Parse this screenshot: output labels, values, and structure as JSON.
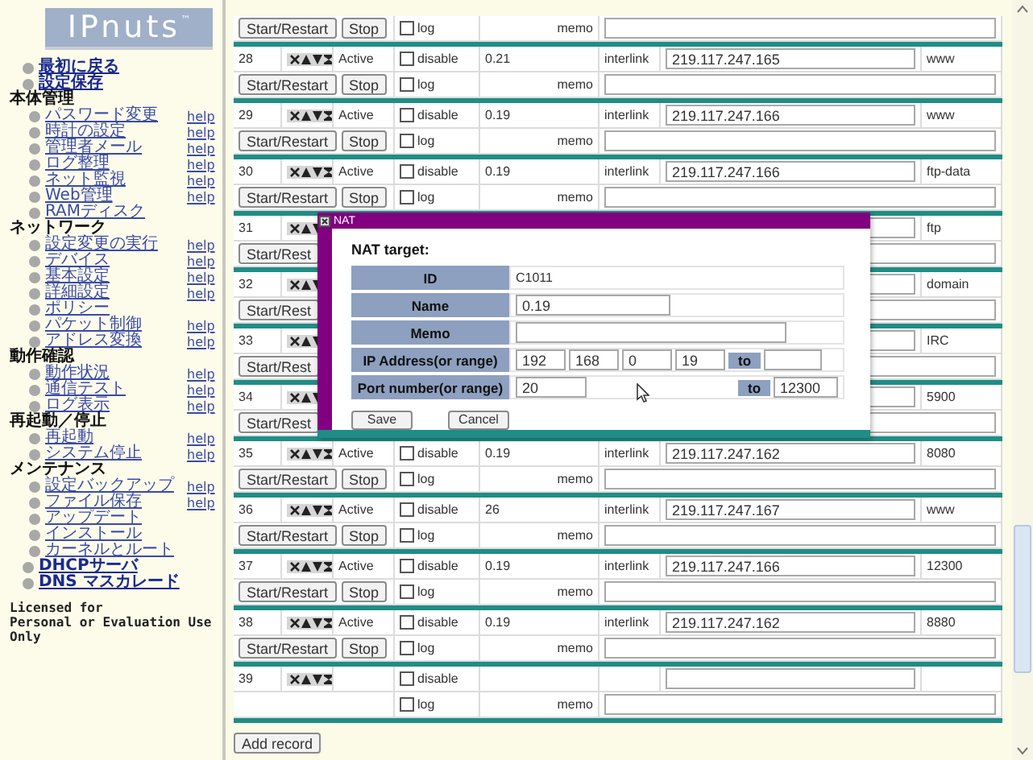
{
  "logo": {
    "text": "IPnuts",
    "mark": "™"
  },
  "menu": [
    {
      "kind": "link",
      "label": "最初に戻る"
    },
    {
      "kind": "link",
      "label": "設定保存"
    },
    {
      "kind": "section",
      "label": "本体管理",
      "children": [
        {
          "label": "パスワード変更",
          "help": "help"
        },
        {
          "label": "時計の設定",
          "help": "help"
        },
        {
          "label": "管理者メール",
          "help": "help"
        },
        {
          "label": "ログ整理",
          "help": "help"
        },
        {
          "label": "ネット監視",
          "help": "help"
        },
        {
          "label": "Web管理",
          "help": "help"
        },
        {
          "label": "RAMディスク"
        }
      ]
    },
    {
      "kind": "section",
      "label": "ネットワーク",
      "children": [
        {
          "label": "設定変更の実行",
          "help": "help"
        },
        {
          "label": "デバイス",
          "help": "help"
        },
        {
          "label": "基本設定",
          "help": "help"
        },
        {
          "label": "詳細設定",
          "help": "help"
        },
        {
          "label": "ポリシー"
        },
        {
          "label": "パケット制御",
          "help": "help"
        },
        {
          "label": "アドレス変換",
          "help": "help"
        }
      ]
    },
    {
      "kind": "section",
      "label": "動作確認",
      "children": [
        {
          "label": "動作状況",
          "help": "help"
        },
        {
          "label": "通信テスト",
          "help": "help"
        },
        {
          "label": "ログ表示",
          "help": "help"
        }
      ]
    },
    {
      "kind": "section",
      "label": "再起動／停止",
      "children": [
        {
          "label": "再起動",
          "help": "help"
        },
        {
          "label": "システム停止",
          "help": "help"
        }
      ]
    },
    {
      "kind": "section",
      "label": "メンテナンス",
      "children": [
        {
          "label": "設定バックアップ",
          "help": "help"
        },
        {
          "label": "ファイル保存",
          "help": "help"
        },
        {
          "label": "アップデート"
        },
        {
          "label": "インストール"
        },
        {
          "label": "カーネルとルート"
        }
      ]
    },
    {
      "kind": "link",
      "label": "DHCPサーバ"
    },
    {
      "kind": "link",
      "label": "DNS マスカレード"
    }
  ],
  "license_lines": [
    "Licensed for",
    "Personal or Evaluation Use",
    "Only"
  ],
  "records": [
    {
      "kind": "tail",
      "start": "Start/Restart",
      "stop": "Stop",
      "log": {
        "label": "log",
        "checked": false
      },
      "memo_label": "memo"
    },
    {
      "kind": "full",
      "number": "28",
      "status": "Active",
      "disable": {
        "label": "disable",
        "checked": false
      },
      "name": "0.21",
      "link": "interlink",
      "ip": "219.117.247.165",
      "port": "www",
      "start": "Start/Restart",
      "stop": "Stop",
      "log": {
        "label": "log",
        "checked": false
      },
      "memo_label": "memo"
    },
    {
      "kind": "full",
      "number": "29",
      "status": "Active",
      "disable": {
        "label": "disable",
        "checked": false
      },
      "name": "0.19",
      "link": "interlink",
      "ip": "219.117.247.166",
      "port": "www",
      "start": "Start/Restart",
      "stop": "Stop",
      "log": {
        "label": "log",
        "checked": false
      },
      "memo_label": "memo"
    },
    {
      "kind": "full",
      "number": "30",
      "status": "Active",
      "disable": {
        "label": "disable",
        "checked": false
      },
      "name": "0.19",
      "link": "interlink",
      "ip": "219.117.247.166",
      "port": "ftp-data",
      "start": "Start/Restart",
      "stop": "Stop",
      "log": {
        "label": "log",
        "checked": false
      },
      "memo_label": "memo"
    },
    {
      "kind": "covered",
      "number": "31",
      "port": "ftp",
      "start": "Start/Rest"
    },
    {
      "kind": "covered",
      "number": "32",
      "port": "domain",
      "start": "Start/Rest"
    },
    {
      "kind": "covered",
      "number": "33",
      "port": "IRC",
      "start": "Start/Rest"
    },
    {
      "kind": "covered",
      "number": "34",
      "port": "5900",
      "start": "Start/Rest"
    },
    {
      "kind": "full",
      "number": "35",
      "status": "Active",
      "disable": {
        "label": "disable",
        "checked": false
      },
      "name": "0.19",
      "link": "interlink",
      "ip": "219.117.247.162",
      "port": "8080",
      "start": "Start/Restart",
      "stop": "Stop",
      "log": {
        "label": "log",
        "checked": false
      },
      "memo_label": "memo"
    },
    {
      "kind": "full",
      "number": "36",
      "status": "Active",
      "disable": {
        "label": "disable",
        "checked": false
      },
      "name": "26",
      "link": "interlink",
      "ip": "219.117.247.167",
      "port": "www",
      "start": "Start/Restart",
      "stop": "Stop",
      "log": {
        "label": "log",
        "checked": false
      },
      "memo_label": "memo"
    },
    {
      "kind": "full",
      "number": "37",
      "status": "Active",
      "disable": {
        "label": "disable",
        "checked": false
      },
      "name": "0.19",
      "link": "interlink",
      "ip": "219.117.247.166",
      "port": "12300",
      "start": "Start/Restart",
      "stop": "Stop",
      "log": {
        "label": "log",
        "checked": false
      },
      "memo_label": "memo"
    },
    {
      "kind": "full",
      "number": "38",
      "status": "Active",
      "disable": {
        "label": "disable",
        "checked": false
      },
      "name": "0.19",
      "link": "interlink",
      "ip": "219.117.247.162",
      "port": "8880",
      "start": "Start/Restart",
      "stop": "Stop",
      "log": {
        "label": "log",
        "checked": false
      },
      "memo_label": "memo"
    },
    {
      "kind": "empty",
      "number": "39",
      "disable": {
        "label": "disable",
        "checked": false
      },
      "log": {
        "label": "log",
        "checked": false
      },
      "memo_label": "memo"
    }
  ],
  "add_button": "Add record",
  "dialog": {
    "title": "NAT",
    "heading": "NAT target:",
    "id": {
      "label": "ID",
      "value": "C1011"
    },
    "name": {
      "label": "Name",
      "value": "0.19"
    },
    "memo": {
      "label": "Memo"
    },
    "ip": {
      "label": "IP Address(or range)",
      "octets": [
        "192",
        "168",
        "0",
        "19"
      ],
      "to": "to"
    },
    "port": {
      "label": "Port number(or range)",
      "value": "20",
      "to": "to",
      "to_value": "12300"
    },
    "buttons": [
      "Save",
      "Cancel"
    ]
  }
}
